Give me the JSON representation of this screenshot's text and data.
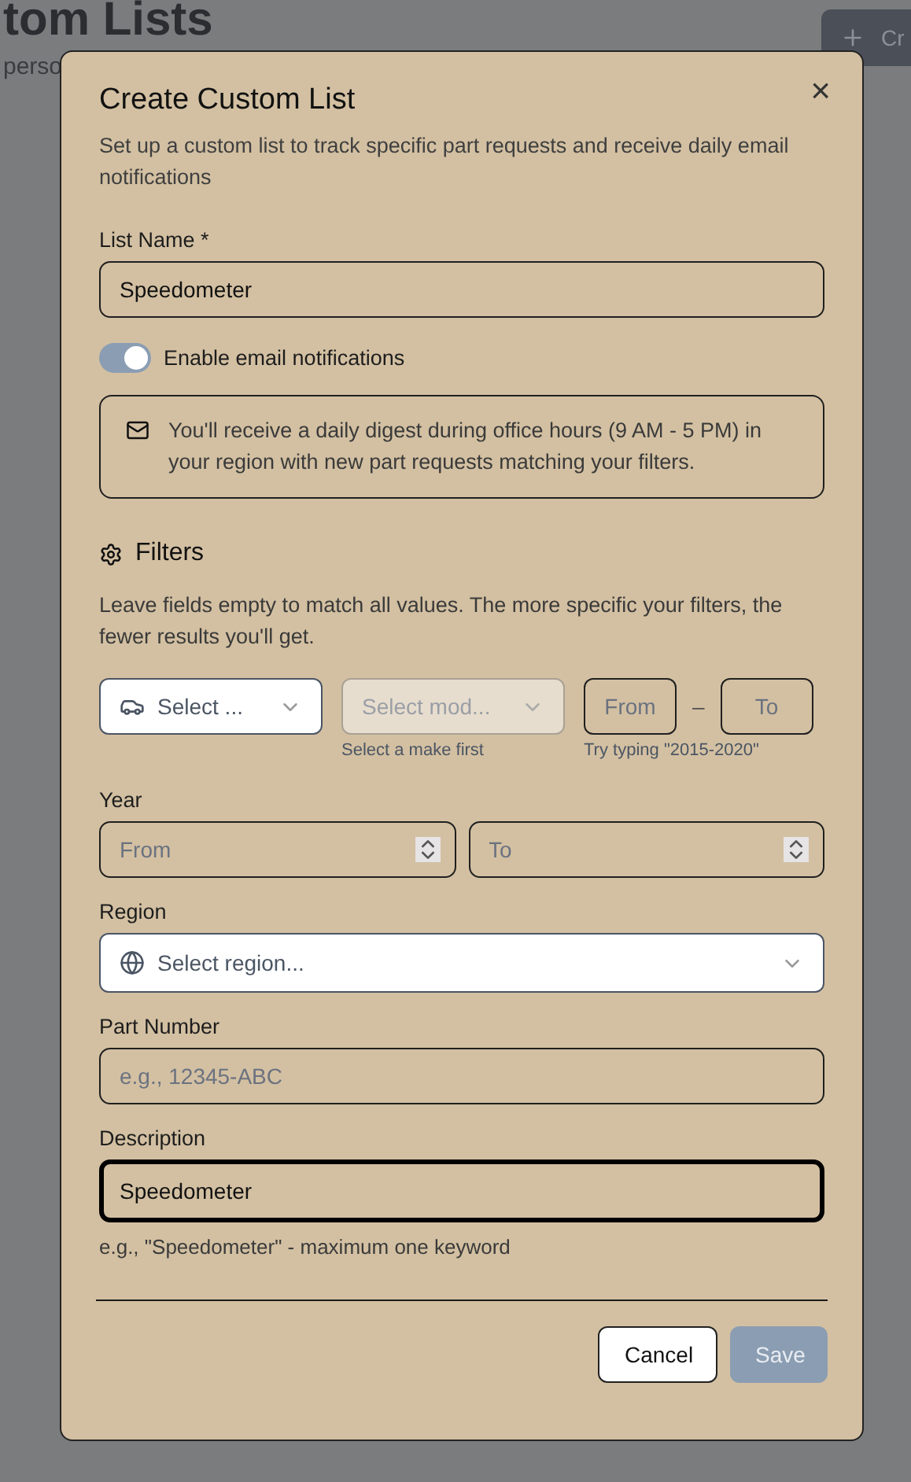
{
  "background_page": {
    "title": "tom Lists",
    "subtitle": "perso",
    "create_button": "Cr"
  },
  "dialog": {
    "title": "Create Custom List",
    "subtitle": "Set up a custom list to track specific part requests and receive daily email notifications",
    "close": "×",
    "list_name": {
      "label": "List Name *",
      "value": "Speedometer"
    },
    "email_toggle": {
      "label": "Enable email notifications",
      "on": true
    },
    "info": "You'll receive a daily digest during office hours (9 AM - 5 PM) in your region with new part requests matching your filters.",
    "filters": {
      "title": "Filters",
      "hint": "Leave fields empty to match all values. The more specific your filters, the fewer results you'll get.",
      "make": {
        "placeholder": "Select ...",
        "disabled": false
      },
      "model": {
        "placeholder": "Select mod...",
        "disabled": true,
        "help": "Select a make first"
      },
      "year_range": {
        "from_placeholder": "From",
        "separator": "–",
        "to_placeholder": "To",
        "help": "Try typing \"2015-2020\""
      },
      "year": {
        "label": "Year",
        "from_placeholder": "From",
        "to_placeholder": "To"
      },
      "region": {
        "label": "Region",
        "placeholder": "Select region..."
      },
      "part_number": {
        "label": "Part Number",
        "placeholder": "e.g., 12345-ABC"
      },
      "description": {
        "label": "Description",
        "value": "Speedometer",
        "focused": true,
        "help": "e.g., \"Speedometer\" - maximum one keyword"
      }
    },
    "buttons": [
      {
        "label": "Cancel",
        "kind": "secondary"
      },
      {
        "label": "Save",
        "kind": "primary",
        "disabled": true
      }
    ]
  }
}
